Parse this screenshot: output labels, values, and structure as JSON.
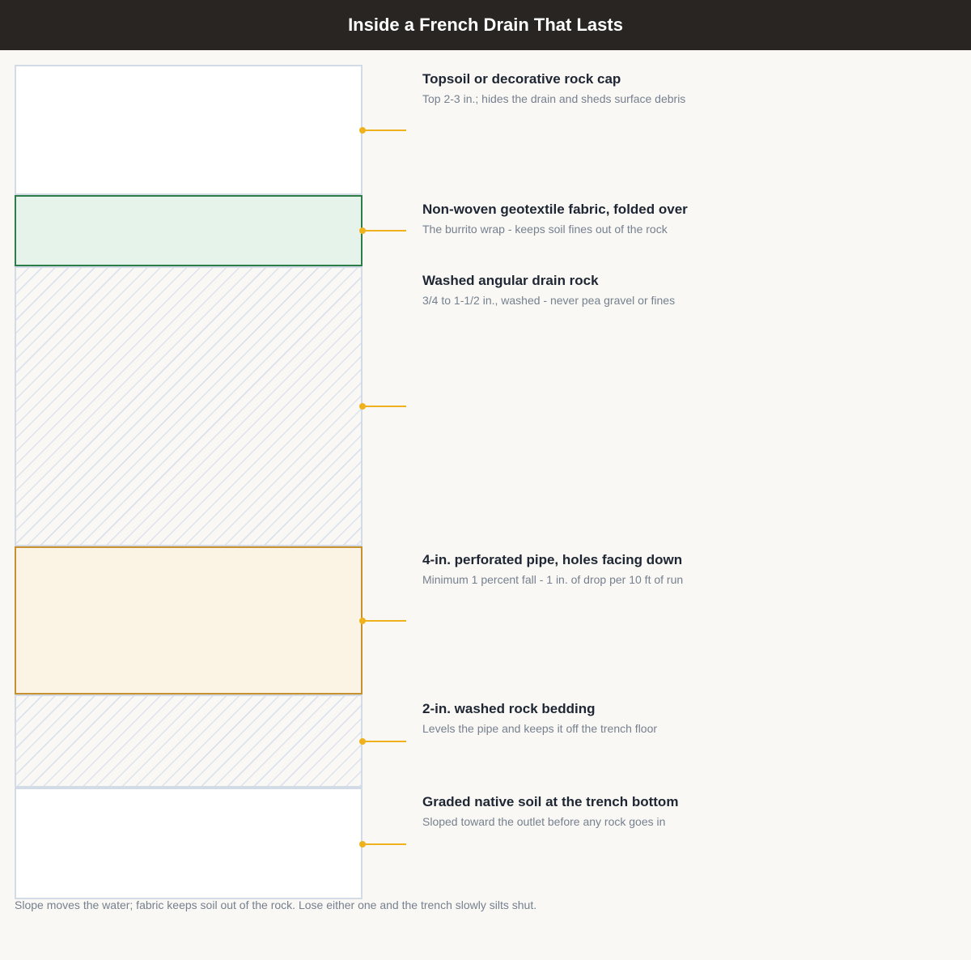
{
  "title": "Inside a French Drain That Lasts",
  "layers": [
    {
      "title": "Topsoil or decorative rock cap",
      "subtitle": "Top 2-3 in.; hides the drain and sheds surface debris"
    },
    {
      "title": "Non-woven geotextile fabric, folded over",
      "subtitle": "The burrito wrap - keeps soil fines out of the rock"
    },
    {
      "title": "Washed angular drain rock",
      "subtitle": "3/4 to 1-1/2 in., washed - never pea gravel or fines"
    },
    {
      "title": "4-in. perforated pipe, holes facing down",
      "subtitle": "Minimum 1 percent fall - 1 in. of drop per 10 ft of run"
    },
    {
      "title": "2-in. washed rock bedding",
      "subtitle": "Levels the pipe and keeps it off the trench floor"
    },
    {
      "title": "Graded native soil at the trench bottom",
      "subtitle": "Sloped toward the outlet before any rock goes in"
    }
  ],
  "caption": "Slope moves the water; fabric keeps soil out of the rock. Lose either one and the trench slowly silts shut.",
  "colors": {
    "header": "#282523",
    "fabric_border": "#2d7d4a",
    "pipe_border": "#c8912f",
    "connector": "#f0b21c"
  }
}
